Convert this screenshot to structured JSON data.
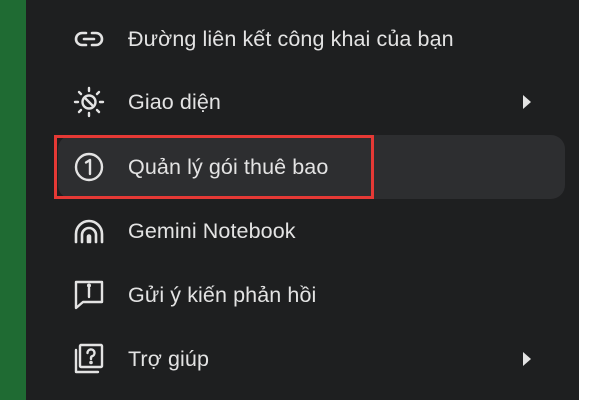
{
  "menu": {
    "items": [
      {
        "label": "Đường liên kết công khai của bạn",
        "icon": "link-icon"
      },
      {
        "label": "Giao diện",
        "icon": "theme-icon"
      },
      {
        "label": "Quản lý gói thuê bao",
        "icon": "subscription-icon"
      },
      {
        "label": "Gemini Notebook",
        "icon": "notebook-icon"
      },
      {
        "label": "Gửi ý kiến phản hồi",
        "icon": "feedback-icon"
      },
      {
        "label": "Trợ giúp",
        "icon": "help-icon"
      }
    ]
  },
  "colors": {
    "panel_background": "#1e1f20",
    "highlight_background": "#2d2e30",
    "text": "#e3e3e3",
    "annotation_border": "#e53935",
    "left_strip": "#1f6b33"
  }
}
